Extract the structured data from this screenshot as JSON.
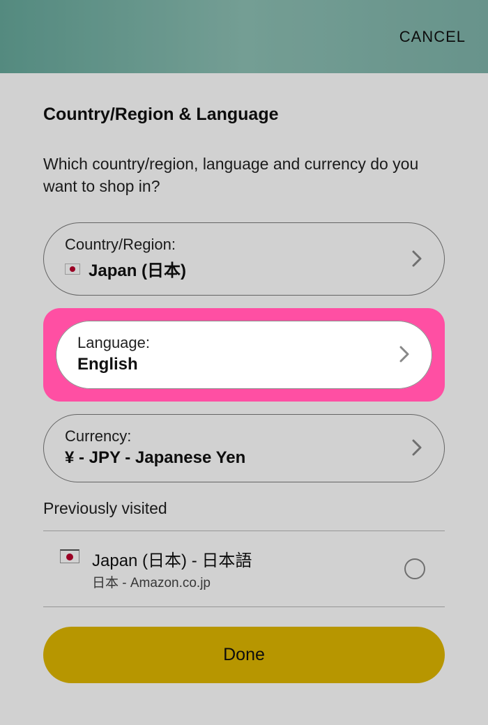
{
  "header": {
    "cancel": "CANCEL"
  },
  "title": "Country/Region & Language",
  "subtitle": "Which country/region, language and currency do you want to shop in?",
  "country": {
    "label": "Country/Region:",
    "value": "Japan (日本)"
  },
  "language": {
    "label": "Language:",
    "value": "English"
  },
  "currency": {
    "label": "Currency:",
    "value": "¥ - JPY - Japanese Yen"
  },
  "previous": {
    "header": "Previously visited",
    "item": {
      "title": "Japan (日本) - 日本語",
      "sub": "日本 - Amazon.co.jp"
    }
  },
  "done": "Done"
}
